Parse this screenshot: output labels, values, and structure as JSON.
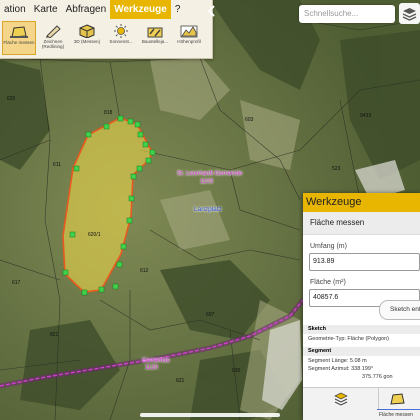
{
  "toolbar": {
    "menu": [
      "ation",
      "Karte",
      "Abfragen",
      "Werkzeuge",
      "?"
    ],
    "active_menu": "Werkzeuge",
    "tools": [
      {
        "label": "Fläche messen",
        "icon": "area-measure-icon",
        "active": true
      },
      {
        "label": "Zeichnen (Redlining)",
        "icon": "pencil-draw-icon",
        "active": false
      },
      {
        "label": "3D (Messen)",
        "icon": "cube-3d-icon",
        "active": false
      },
      {
        "label": "Sonnenst...",
        "icon": "sun-icon",
        "active": false
      },
      {
        "label": "Baustelleja...",
        "icon": "construction-icon",
        "active": false
      },
      {
        "label": "Höhenprofil",
        "icon": "elevation-profile-icon",
        "active": false
      }
    ]
  },
  "search": {
    "placeholder": "Schnellsuche..."
  },
  "map": {
    "labels": [
      {
        "text": "St. Leonhardt Gemeinde",
        "color": "#d43cd4"
      },
      {
        "text": "1103",
        "color": "#d43cd4"
      },
      {
        "text": "Lanzplatz",
        "color": "#2b4fd1"
      },
      {
        "text": "Gemeinde",
        "color": "#d43cd4"
      },
      {
        "text": "1130",
        "color": "#d43cd4"
      }
    ],
    "parcel_numbers": [
      "620",
      "611",
      "818",
      "603",
      "620/1",
      "612",
      "617",
      "821",
      "697",
      "630",
      "9433",
      "523",
      "621"
    ]
  },
  "panel": {
    "title": "Werkzeuge",
    "subtitle": "Fläche messen",
    "umfang_label": "Umfang (m)",
    "umfang_value": "913.89",
    "flaeche_label": "Fläche (m²)",
    "flaeche_value": "40857.6",
    "sketch_button": "Sketch entf",
    "sketch_head": "Sketch",
    "geometry_type": "Geometrie-Typ: Fläche (Polygon)",
    "segment_head": "Segment",
    "segment_length": "Segment Länge:   5.08 m",
    "segment_azimuth": "Segment Azimut:   338.199°",
    "segment_gon": "375.776 gon",
    "footer_label": "Fläche messen"
  },
  "colors": {
    "accent": "#e8b500",
    "polygon_fill": "#e6d24a",
    "vertex": "#3fd24a",
    "boundary": "#d43cd4"
  }
}
